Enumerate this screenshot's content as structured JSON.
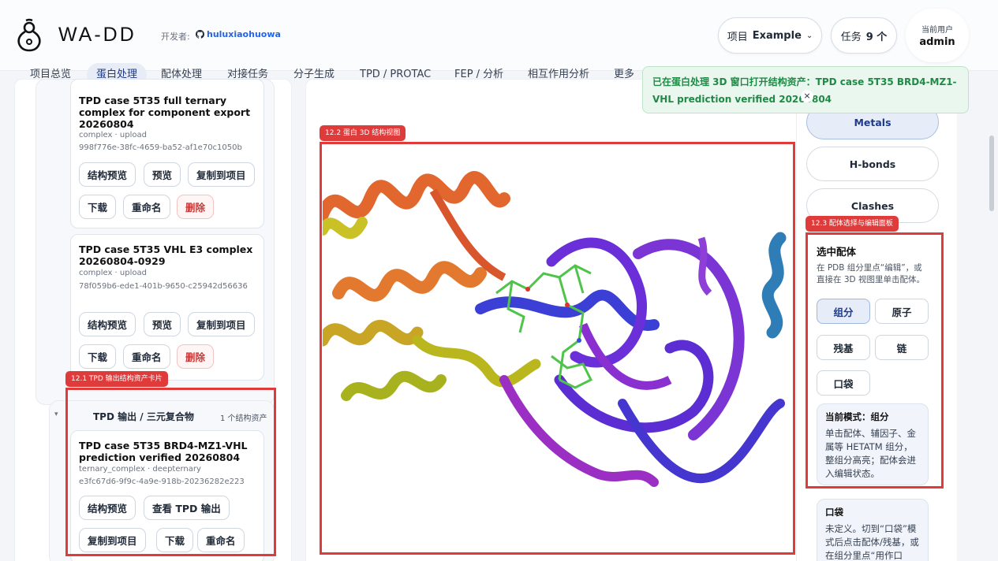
{
  "app": {
    "brand": "WA-DD",
    "developer_label": "开发者:",
    "developer_name": "huluxiaohuowa"
  },
  "header": {
    "project_label": "项目",
    "project_value": "Example",
    "tasks_label": "任务",
    "tasks_value": "9 个",
    "user_label": "当前用户",
    "user_name": "admin"
  },
  "nav": {
    "tabs": [
      {
        "label": "项目总览"
      },
      {
        "label": "蛋白处理"
      },
      {
        "label": "配体处理"
      },
      {
        "label": "对接任务"
      },
      {
        "label": "分子生成"
      },
      {
        "label": "TPD / PROTAC"
      },
      {
        "label": "FEP / 分析"
      },
      {
        "label": "相互作用分析"
      },
      {
        "label": "更多"
      }
    ],
    "active_index": 1
  },
  "toast": {
    "message": "已在蛋白处理 3D 窗口打开结构资产：TPD case 5T35 BRD4-MZ1-VHL prediction verified 20260804",
    "close": "×"
  },
  "left": {
    "cards": [
      {
        "title": "TPD case 5T35 full ternary complex for component export 20260804",
        "meta": "complex · upload",
        "id": "998f776e-38fc-4659-ba52-af1e70c1050b",
        "buttons": [
          "结构预览",
          "预览",
          "复制到项目",
          "下载",
          "重命名",
          "删除"
        ]
      },
      {
        "title": "TPD case 5T35 VHL E3 complex 20260804-0929",
        "meta": "complex · upload",
        "id": "78f059b6-ede1-401b-9650-c25942d56636",
        "buttons": [
          "结构预览",
          "预览",
          "复制到项目",
          "下载",
          "重命名",
          "删除"
        ]
      }
    ],
    "group": {
      "caret": "▾",
      "title": "TPD 输出 / 三元复合物",
      "count": "1 个结构资产",
      "card": {
        "title": "TPD case 5T35 BRD4-MZ1-VHL prediction verified 20260804",
        "meta": "ternary_complex · deepternary",
        "id": "e3fc67d6-9f9c-4a9e-918b-20236282e223",
        "buttons": [
          "结构预览",
          "查看 TPD 输出",
          "复制到项目",
          "下载",
          "重命名"
        ]
      }
    }
  },
  "right": {
    "toggles": [
      {
        "label": "Metals",
        "active": true
      },
      {
        "label": "H-bonds",
        "active": false
      },
      {
        "label": "Clashes",
        "active": false
      }
    ],
    "select": {
      "title": "选中配体",
      "hint": "在 PDB 组分里点“编辑”，或直接在 3D 视图里单击配体。",
      "modes": [
        "组分",
        "原子",
        "残基",
        "链",
        "口袋"
      ],
      "active_mode": 0,
      "info_title": "当前模式：组分",
      "info_body": "单击配体、辅因子、金属等 HETATM 组分，整组分高亮；配体会进入编辑状态。"
    },
    "pocket": {
      "title": "口袋",
      "body": "未定义。切到“口袋”模式后点击配体/残基，或在组分里点“用作口"
    }
  },
  "annotations": [
    {
      "label": "12.1 TPD 输出结构资产卡片"
    },
    {
      "label": "12.2 蛋白 3D 结构视图"
    },
    {
      "label": "12.3 配体选择与编辑面板"
    }
  ],
  "colors": {
    "accent": "#1e3a8a",
    "annotation": "#e03b3b",
    "success": "#1f8a45",
    "danger": "#c43a3a"
  }
}
